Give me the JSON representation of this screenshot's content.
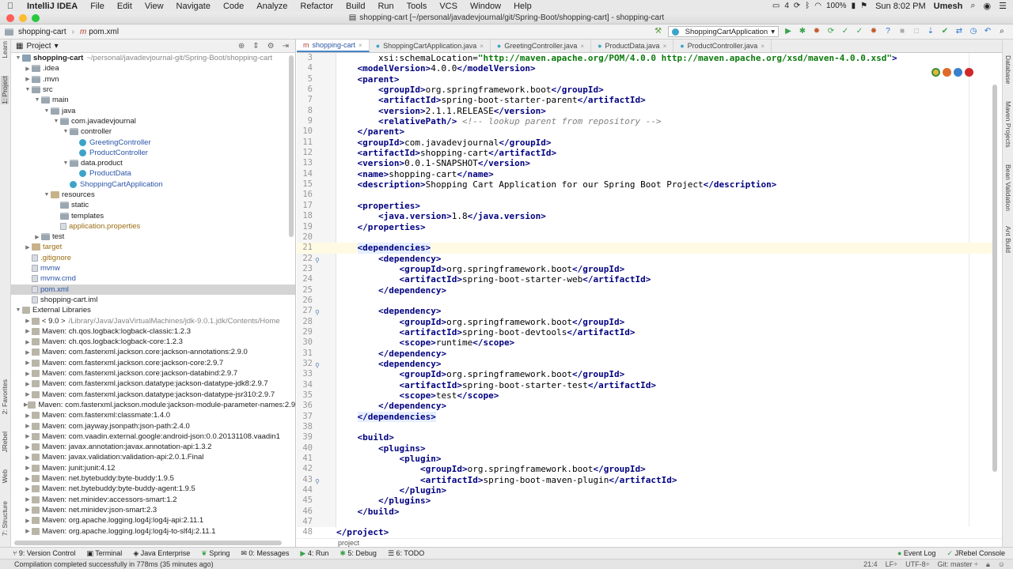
{
  "menubar": {
    "app": "IntelliJ IDEA",
    "items": [
      "File",
      "Edit",
      "View",
      "Navigate",
      "Code",
      "Analyze",
      "Refactor",
      "Build",
      "Run",
      "Tools",
      "VCS",
      "Window",
      "Help"
    ],
    "tray_count": "4",
    "battery": "100%",
    "clock": "Sun 8:02 PM",
    "user": "Umesh"
  },
  "window": {
    "title": "shopping-cart [~/personal/javadevjournal/git/Spring-Boot/shopping-cart] - shopping-cart"
  },
  "breadcrumb": {
    "project": "shopping-cart",
    "file": "pom.xml",
    "run_config": "ShoppingCartApplication"
  },
  "side_labels": {
    "left": [
      "1: Project",
      "2: Favorites",
      "JRebel",
      "Web",
      "7: Structure",
      "Learn"
    ],
    "right": [
      "Database",
      "Maven Projects",
      "Bean Validation",
      "Ant Build"
    ]
  },
  "project_panel": {
    "title": "Project",
    "tree": [
      {
        "label": "shopping-cart",
        "extra": "~/personal/javadevjournal-git/Spring-Boot/shopping-cart",
        "indent": 0,
        "icon": "mod",
        "open": true,
        "bold": true
      },
      {
        "label": ".idea",
        "indent": 1,
        "icon": "folder",
        "open": false
      },
      {
        "label": ".mvn",
        "indent": 1,
        "icon": "folder",
        "open": false
      },
      {
        "label": "src",
        "indent": 1,
        "icon": "folder",
        "open": true
      },
      {
        "label": "main",
        "indent": 2,
        "icon": "folder",
        "open": true
      },
      {
        "label": "java",
        "indent": 3,
        "icon": "folder",
        "open": true
      },
      {
        "label": "com.javadevjournal",
        "indent": 4,
        "icon": "folder",
        "open": true
      },
      {
        "label": "controller",
        "indent": 5,
        "icon": "folder",
        "open": true
      },
      {
        "label": "GreetingController",
        "indent": 6,
        "icon": "cls",
        "color": "blue"
      },
      {
        "label": "ProductController",
        "indent": 6,
        "icon": "cls",
        "color": "blue"
      },
      {
        "label": "data.product",
        "indent": 5,
        "icon": "folder",
        "open": true
      },
      {
        "label": "ProductData",
        "indent": 6,
        "icon": "cls",
        "color": "blue"
      },
      {
        "label": "ShoppingCartApplication",
        "indent": 5,
        "icon": "cls",
        "color": "blue"
      },
      {
        "label": "resources",
        "indent": 3,
        "icon": "res",
        "open": true
      },
      {
        "label": "static",
        "indent": 4,
        "icon": "folder"
      },
      {
        "label": "templates",
        "indent": 4,
        "icon": "folder"
      },
      {
        "label": "application.properties",
        "indent": 4,
        "icon": "file",
        "color": "brown"
      },
      {
        "label": "test",
        "indent": 2,
        "icon": "folder",
        "open": false
      },
      {
        "label": "target",
        "indent": 1,
        "icon": "res",
        "open": false,
        "color": "brown"
      },
      {
        "label": ".gitignore",
        "indent": 1,
        "icon": "file",
        "color": "brown"
      },
      {
        "label": "mvnw",
        "indent": 1,
        "icon": "file",
        "color": "blue"
      },
      {
        "label": "mvnw.cmd",
        "indent": 1,
        "icon": "file",
        "color": "blue"
      },
      {
        "label": "pom.xml",
        "indent": 1,
        "icon": "file",
        "color": "blue",
        "selected": true
      },
      {
        "label": "shopping-cart.iml",
        "indent": 1,
        "icon": "file"
      },
      {
        "label": "External Libraries",
        "indent": 0,
        "icon": "lib",
        "open": true
      },
      {
        "label": "< 9.0 >",
        "extra": "/Library/Java/JavaVirtualMachines/jdk-9.0.1.jdk/Contents/Home",
        "indent": 1,
        "icon": "lib",
        "open": false
      },
      {
        "label": "Maven: ch.qos.logback:logback-classic:1.2.3",
        "indent": 1,
        "icon": "lib",
        "open": false
      },
      {
        "label": "Maven: ch.qos.logback:logback-core:1.2.3",
        "indent": 1,
        "icon": "lib",
        "open": false
      },
      {
        "label": "Maven: com.fasterxml.jackson.core:jackson-annotations:2.9.0",
        "indent": 1,
        "icon": "lib",
        "open": false
      },
      {
        "label": "Maven: com.fasterxml.jackson.core:jackson-core:2.9.7",
        "indent": 1,
        "icon": "lib",
        "open": false
      },
      {
        "label": "Maven: com.fasterxml.jackson.core:jackson-databind:2.9.7",
        "indent": 1,
        "icon": "lib",
        "open": false
      },
      {
        "label": "Maven: com.fasterxml.jackson.datatype:jackson-datatype-jdk8:2.9.7",
        "indent": 1,
        "icon": "lib",
        "open": false
      },
      {
        "label": "Maven: com.fasterxml.jackson.datatype:jackson-datatype-jsr310:2.9.7",
        "indent": 1,
        "icon": "lib",
        "open": false
      },
      {
        "label": "Maven: com.fasterxml.jackson.module:jackson-module-parameter-names:2.9",
        "indent": 1,
        "icon": "lib",
        "open": false
      },
      {
        "label": "Maven: com.fasterxml:classmate:1.4.0",
        "indent": 1,
        "icon": "lib",
        "open": false
      },
      {
        "label": "Maven: com.jayway.jsonpath:json-path:2.4.0",
        "indent": 1,
        "icon": "lib",
        "open": false
      },
      {
        "label": "Maven: com.vaadin.external.google:android-json:0.0.20131108.vaadin1",
        "indent": 1,
        "icon": "lib",
        "open": false
      },
      {
        "label": "Maven: javax.annotation:javax.annotation-api:1.3.2",
        "indent": 1,
        "icon": "lib",
        "open": false
      },
      {
        "label": "Maven: javax.validation:validation-api:2.0.1.Final",
        "indent": 1,
        "icon": "lib",
        "open": false
      },
      {
        "label": "Maven: junit:junit:4.12",
        "indent": 1,
        "icon": "lib",
        "open": false
      },
      {
        "label": "Maven: net.bytebuddy:byte-buddy:1.9.5",
        "indent": 1,
        "icon": "lib",
        "open": false
      },
      {
        "label": "Maven: net.bytebuddy:byte-buddy-agent:1.9.5",
        "indent": 1,
        "icon": "lib",
        "open": false
      },
      {
        "label": "Maven: net.minidev:accessors-smart:1.2",
        "indent": 1,
        "icon": "lib",
        "open": false
      },
      {
        "label": "Maven: net.minidev:json-smart:2.3",
        "indent": 1,
        "icon": "lib",
        "open": false
      },
      {
        "label": "Maven: org.apache.logging.log4j:log4j-api:2.11.1",
        "indent": 1,
        "icon": "lib",
        "open": false
      },
      {
        "label": "Maven: org.apache.logging.log4j:log4j-to-slf4j:2.11.1",
        "indent": 1,
        "icon": "lib",
        "open": false
      }
    ]
  },
  "editor": {
    "tabs": [
      {
        "label": "shopping-cart",
        "active": true
      },
      {
        "label": "ShoppingCartApplication.java",
        "active": false
      },
      {
        "label": "GreetingController.java",
        "active": false
      },
      {
        "label": "ProductData.java",
        "active": false
      },
      {
        "label": "ProductController.java",
        "active": false
      }
    ],
    "lines": [
      {
        "n": "3",
        "indent": 8,
        "parts": [
          {
            "t": "xsi:schemaLocation=",
            "c": "tx"
          },
          {
            "t": "\"http://maven.apache.org/POM/4.0.0 http://maven.apache.org/xsd/maven-4.0.0.xsd\"",
            "c": "st"
          },
          {
            "t": ">",
            "c": "tg"
          }
        ]
      },
      {
        "n": "4",
        "indent": 4,
        "parts": [
          {
            "t": "<modelVersion>",
            "c": "tg"
          },
          {
            "t": "4.0.0",
            "c": "tx"
          },
          {
            "t": "</modelVersion>",
            "c": "tg"
          }
        ]
      },
      {
        "n": "5",
        "indent": 4,
        "parts": [
          {
            "t": "<parent>",
            "c": "tg"
          }
        ]
      },
      {
        "n": "6",
        "indent": 8,
        "parts": [
          {
            "t": "<groupId>",
            "c": "tg"
          },
          {
            "t": "org.springframework.boot",
            "c": "tx"
          },
          {
            "t": "</groupId>",
            "c": "tg"
          }
        ]
      },
      {
        "n": "7",
        "indent": 8,
        "parts": [
          {
            "t": "<artifactId>",
            "c": "tg"
          },
          {
            "t": "spring-boot-starter-parent",
            "c": "tx"
          },
          {
            "t": "</artifactId>",
            "c": "tg"
          }
        ]
      },
      {
        "n": "8",
        "indent": 8,
        "parts": [
          {
            "t": "<version>",
            "c": "tg"
          },
          {
            "t": "2.1.1.RELEASE",
            "c": "tx"
          },
          {
            "t": "</version>",
            "c": "tg"
          }
        ]
      },
      {
        "n": "9",
        "indent": 8,
        "parts": [
          {
            "t": "<relativePath/>",
            "c": "tg"
          },
          {
            "t": " <!-- lookup parent from repository -->",
            "c": "cm"
          }
        ]
      },
      {
        "n": "10",
        "indent": 4,
        "parts": [
          {
            "t": "</parent>",
            "c": "tg"
          }
        ]
      },
      {
        "n": "11",
        "indent": 4,
        "parts": [
          {
            "t": "<groupId>",
            "c": "tg"
          },
          {
            "t": "com.javadevjournal",
            "c": "tx"
          },
          {
            "t": "</groupId>",
            "c": "tg"
          }
        ]
      },
      {
        "n": "12",
        "indent": 4,
        "parts": [
          {
            "t": "<artifactId>",
            "c": "tg"
          },
          {
            "t": "shopping-cart",
            "c": "tx"
          },
          {
            "t": "</artifactId>",
            "c": "tg"
          }
        ]
      },
      {
        "n": "13",
        "indent": 4,
        "parts": [
          {
            "t": "<version>",
            "c": "tg"
          },
          {
            "t": "0.0.1-SNAPSHOT",
            "c": "tx"
          },
          {
            "t": "</version>",
            "c": "tg"
          }
        ]
      },
      {
        "n": "14",
        "indent": 4,
        "parts": [
          {
            "t": "<name>",
            "c": "tg"
          },
          {
            "t": "shopping-cart",
            "c": "tx"
          },
          {
            "t": "</name>",
            "c": "tg"
          }
        ]
      },
      {
        "n": "15",
        "indent": 4,
        "parts": [
          {
            "t": "<description>",
            "c": "tg"
          },
          {
            "t": "Shopping Cart Application for our Spring Boot Project",
            "c": "tx"
          },
          {
            "t": "</description>",
            "c": "tg"
          }
        ]
      },
      {
        "n": "16",
        "indent": 0,
        "parts": []
      },
      {
        "n": "17",
        "indent": 4,
        "parts": [
          {
            "t": "<properties>",
            "c": "tg"
          }
        ]
      },
      {
        "n": "18",
        "indent": 8,
        "parts": [
          {
            "t": "<java.version>",
            "c": "tg"
          },
          {
            "t": "1.8",
            "c": "tx"
          },
          {
            "t": "</java.version>",
            "c": "tg"
          }
        ]
      },
      {
        "n": "19",
        "indent": 4,
        "parts": [
          {
            "t": "</properties>",
            "c": "tg"
          }
        ]
      },
      {
        "n": "20",
        "indent": 0,
        "parts": []
      },
      {
        "n": "21",
        "indent": 4,
        "cur": true,
        "parts": [
          {
            "t": "<dependencies>",
            "c": "tg hl"
          }
        ]
      },
      {
        "n": "22",
        "indent": 8,
        "mark": true,
        "parts": [
          {
            "t": "<dependency>",
            "c": "tg"
          }
        ]
      },
      {
        "n": "23",
        "indent": 12,
        "parts": [
          {
            "t": "<groupId>",
            "c": "tg"
          },
          {
            "t": "org.springframework.boot",
            "c": "tx"
          },
          {
            "t": "</groupId>",
            "c": "tg"
          }
        ]
      },
      {
        "n": "24",
        "indent": 12,
        "parts": [
          {
            "t": "<artifactId>",
            "c": "tg"
          },
          {
            "t": "spring-boot-starter-web",
            "c": "tx"
          },
          {
            "t": "</artifactId>",
            "c": "tg"
          }
        ]
      },
      {
        "n": "25",
        "indent": 8,
        "parts": [
          {
            "t": "</dependency>",
            "c": "tg"
          }
        ]
      },
      {
        "n": "26",
        "indent": 0,
        "parts": []
      },
      {
        "n": "27",
        "indent": 8,
        "mark": true,
        "parts": [
          {
            "t": "<dependency>",
            "c": "tg"
          }
        ]
      },
      {
        "n": "28",
        "indent": 12,
        "parts": [
          {
            "t": "<groupId>",
            "c": "tg"
          },
          {
            "t": "org.springframework.boot",
            "c": "tx"
          },
          {
            "t": "</groupId>",
            "c": "tg"
          }
        ]
      },
      {
        "n": "29",
        "indent": 12,
        "parts": [
          {
            "t": "<artifactId>",
            "c": "tg"
          },
          {
            "t": "spring-boot-devtools",
            "c": "tx"
          },
          {
            "t": "</artifactId>",
            "c": "tg"
          }
        ]
      },
      {
        "n": "30",
        "indent": 12,
        "parts": [
          {
            "t": "<scope>",
            "c": "tg"
          },
          {
            "t": "runtime",
            "c": "tx"
          },
          {
            "t": "</scope>",
            "c": "tg"
          }
        ]
      },
      {
        "n": "31",
        "indent": 8,
        "parts": [
          {
            "t": "</dependency>",
            "c": "tg"
          }
        ]
      },
      {
        "n": "32",
        "indent": 8,
        "mark": true,
        "parts": [
          {
            "t": "<dependency>",
            "c": "tg"
          }
        ]
      },
      {
        "n": "33",
        "indent": 12,
        "parts": [
          {
            "t": "<groupId>",
            "c": "tg"
          },
          {
            "t": "org.springframework.boot",
            "c": "tx"
          },
          {
            "t": "</groupId>",
            "c": "tg"
          }
        ]
      },
      {
        "n": "34",
        "indent": 12,
        "parts": [
          {
            "t": "<artifactId>",
            "c": "tg"
          },
          {
            "t": "spring-boot-starter-test",
            "c": "tx"
          },
          {
            "t": "</artifactId>",
            "c": "tg"
          }
        ]
      },
      {
        "n": "35",
        "indent": 12,
        "parts": [
          {
            "t": "<scope>",
            "c": "tg"
          },
          {
            "t": "test",
            "c": "tx"
          },
          {
            "t": "</scope>",
            "c": "tg"
          }
        ]
      },
      {
        "n": "36",
        "indent": 8,
        "parts": [
          {
            "t": "</dependency>",
            "c": "tg"
          }
        ]
      },
      {
        "n": "37",
        "indent": 4,
        "parts": [
          {
            "t": "</dependencies>",
            "c": "tg hl"
          }
        ]
      },
      {
        "n": "38",
        "indent": 0,
        "parts": []
      },
      {
        "n": "39",
        "indent": 4,
        "parts": [
          {
            "t": "<build>",
            "c": "tg"
          }
        ]
      },
      {
        "n": "40",
        "indent": 8,
        "parts": [
          {
            "t": "<plugins>",
            "c": "tg"
          }
        ]
      },
      {
        "n": "41",
        "indent": 12,
        "parts": [
          {
            "t": "<plugin>",
            "c": "tg"
          }
        ]
      },
      {
        "n": "42",
        "indent": 16,
        "parts": [
          {
            "t": "<groupId>",
            "c": "tg"
          },
          {
            "t": "org.springframework.boot",
            "c": "tx"
          },
          {
            "t": "</groupId>",
            "c": "tg"
          }
        ]
      },
      {
        "n": "43",
        "indent": 16,
        "mark": true,
        "parts": [
          {
            "t": "<artifactId>",
            "c": "tg"
          },
          {
            "t": "spring-boot-maven-plugin",
            "c": "tx"
          },
          {
            "t": "</artifactId>",
            "c": "tg"
          }
        ]
      },
      {
        "n": "44",
        "indent": 12,
        "parts": [
          {
            "t": "</plugin>",
            "c": "tg"
          }
        ]
      },
      {
        "n": "45",
        "indent": 8,
        "parts": [
          {
            "t": "</plugins>",
            "c": "tg"
          }
        ]
      },
      {
        "n": "46",
        "indent": 4,
        "parts": [
          {
            "t": "</build>",
            "c": "tg"
          }
        ]
      },
      {
        "n": "47",
        "indent": 0,
        "parts": []
      },
      {
        "n": "48",
        "indent": 0,
        "parts": [
          {
            "t": "</project>",
            "c": "tg"
          }
        ]
      }
    ],
    "footer_crumb": "project"
  },
  "tool_windows": {
    "left": [
      "9: Version Control",
      "Terminal",
      "Java Enterprise",
      "Spring",
      "0: Messages",
      "4: Run",
      "5: Debug",
      "6: TODO"
    ],
    "right": [
      "Event Log",
      "JRebel Console"
    ]
  },
  "statusbar": {
    "message": "Compilation completed successfully in 778ms (35 minutes ago)",
    "position": "21:4",
    "line_sep": "LF÷",
    "encoding": "UTF-8÷",
    "git": "Git: master ÷"
  }
}
